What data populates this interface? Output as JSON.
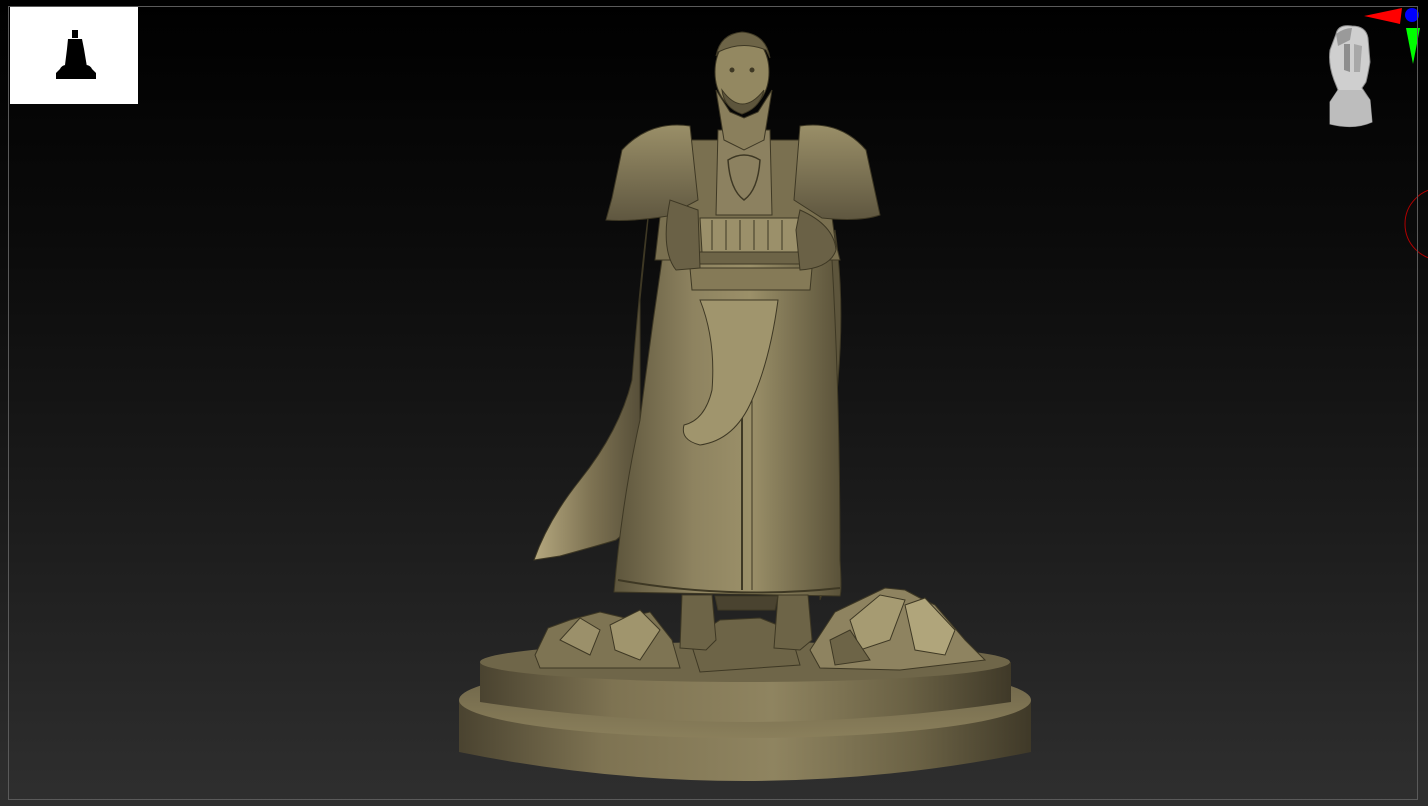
{
  "viewport": {
    "background_top": "#000000",
    "background_bottom": "#2f2f2f",
    "frame_color": "#5a5a5a"
  },
  "thumbnail": {
    "icon": "silhouette-thumbnail-icon",
    "background": "#ffffff",
    "silhouette_color": "#000000"
  },
  "model": {
    "icon": "sculpt-mesh",
    "material_color": "#8c7f58",
    "highlight_color": "#c2b489",
    "shadow_color": "#3e3824"
  },
  "navigation": {
    "head_icon": "orientation-head-icon",
    "x_axis_color": "#ff0000",
    "y_axis_color": "#00ff00",
    "z_axis_color": "#0000ff"
  },
  "brush": {
    "icon": "brush-cursor-ring",
    "color": "#b00000"
  }
}
